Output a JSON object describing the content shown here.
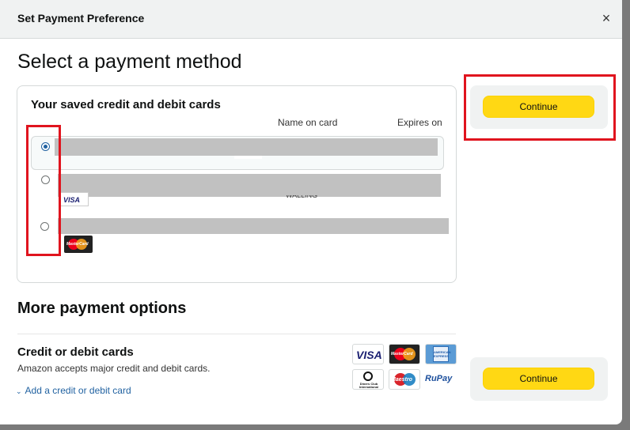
{
  "dialog": {
    "title": "Set Payment Preference",
    "close_glyph": "×"
  },
  "main": {
    "heading": "Select a payment method"
  },
  "saved_cards": {
    "title": "Your saved credit and debit cards",
    "columns": {
      "name": "Name on card",
      "expires": "Expires on"
    },
    "rows": [
      {
        "selected": true,
        "brand": "unknown"
      },
      {
        "selected": false,
        "brand": "visa",
        "brand_label": "VISA",
        "partial_name_text": "WALLING"
      },
      {
        "selected": false,
        "brand": "mastercard",
        "brand_label": "MasterCard"
      }
    ]
  },
  "continue_top": {
    "label": "Continue"
  },
  "continue_bottom": {
    "label": "Continue"
  },
  "more_options": {
    "title": "More payment options",
    "credit_debit": {
      "title": "Credit or debit cards",
      "subtitle": "Amazon accepts major credit and debit cards.",
      "add_link": "Add a credit or debit card",
      "chevron_icon": "chevron-down-icon"
    },
    "accepted_logos": [
      {
        "name": "visa",
        "label": "VISA"
      },
      {
        "name": "mastercard",
        "label": "MasterCard"
      },
      {
        "name": "american-express",
        "label": "AMERICAN EXPRESS"
      },
      {
        "name": "diners-club",
        "label": "Diners Club International"
      },
      {
        "name": "maestro",
        "label": "Maestro"
      },
      {
        "name": "rupay",
        "label": "RuPay"
      }
    ]
  },
  "colors": {
    "accent_blue": "#2162a1",
    "button_yellow": "#ffd814",
    "highlight_red": "#e0141e",
    "header_bg": "#f0f2f2"
  }
}
